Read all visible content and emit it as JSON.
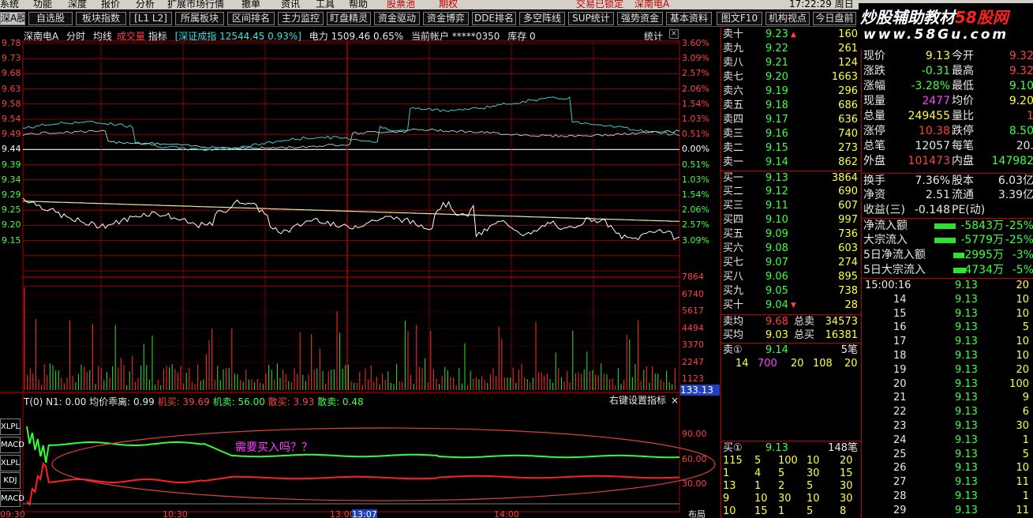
{
  "menubar": {
    "items": [
      "系统",
      "功能",
      "深度",
      "报价",
      "分析",
      "扩展市场行情",
      "撤单",
      "资讯",
      "工具",
      "帮助"
    ],
    "center_items": [
      "股票池",
      "期权"
    ],
    "status": "交易已锁定",
    "stock": "深南电A",
    "clock": "17:22:29 周日"
  },
  "toolbar": {
    "tabs": [
      "深A股",
      "自选股",
      "板块指数",
      "[L1 L2]",
      "所属板块",
      "区间排名",
      "主力监控",
      "盯盘精灵",
      "资金驱动",
      "资金博弈",
      "DDE排名",
      "多空阵线",
      "SUP统计",
      "强势资金",
      "基本资料",
      "图文F10",
      "机构视点",
      "今日盘前"
    ]
  },
  "watermark": {
    "line1_a": "炒股辅助教材",
    "line1_b": "58股网",
    "line2": "www.58Gu.com"
  },
  "chart": {
    "stock_name": "深南电A",
    "mode": "分时",
    "avg_line": "均线",
    "volume_label": "成交量",
    "indicator": "指标",
    "index_info": "[深证成指 12544.45 0.93%]",
    "sector_info": "电力 1509.46 0.65%",
    "account": "当前帐户 *****0350",
    "stock_held": "库存 0",
    "stats": "统计",
    "price_ticks": [
      "9.78",
      "9.73",
      "9.68",
      "9.63",
      "9.58",
      "9.54",
      "9.49",
      "9.44",
      "9.39",
      "9.34",
      "9.29",
      "9.25",
      "9.20",
      "9.15"
    ],
    "pct_ticks": [
      "3.60%",
      "3.09%",
      "2.57%",
      "2.06%",
      "1.54%",
      "1.03%",
      "0.51%",
      "0.00%",
      "0.51%",
      "1.03%",
      "1.54%",
      "2.06%",
      "2.57%",
      "3.09%"
    ],
    "vol_ticks": [
      "7864",
      "6740",
      "5617",
      "4494",
      "3370",
      "2247",
      "1123"
    ],
    "vol_current": "133.13",
    "ind_header": {
      "t": "T(0)",
      "n1": "N1: 0.00",
      "ratio": "均价乖离: 0.99",
      "jibuy": "机买: 39.69",
      "jisell": "机卖: 56.00",
      "sanbuy": "散买: 3.93",
      "sansell": "散卖: 0.48",
      "right_hint": "右键设置指标",
      "close": "×"
    },
    "ind_ticks": [
      "90.00",
      "60.00",
      "30.00"
    ],
    "annotation": "需要买入吗？？",
    "ind_buttons": [
      "XLPL",
      "MACD",
      "XLPL",
      "KDJ",
      "MACD"
    ],
    "time_labels": [
      "09:30",
      "10:30",
      "13:00",
      "13:07",
      "14:00"
    ],
    "bottom_right": "布局"
  },
  "quote": {
    "sells": [
      {
        "label": "卖十",
        "price": "9.23",
        "vol": "160",
        "mark": "▲"
      },
      {
        "label": "卖九",
        "price": "9.22",
        "vol": "261",
        "mark": ""
      },
      {
        "label": "卖八",
        "price": "9.21",
        "vol": "124",
        "mark": ""
      },
      {
        "label": "卖七",
        "price": "9.20",
        "vol": "1663",
        "mark": ""
      },
      {
        "label": "卖六",
        "price": "9.19",
        "vol": "296",
        "mark": ""
      },
      {
        "label": "卖五",
        "price": "9.18",
        "vol": "686",
        "mark": ""
      },
      {
        "label": "卖四",
        "price": "9.17",
        "vol": "636",
        "mark": ""
      },
      {
        "label": "卖三",
        "price": "9.16",
        "vol": "740",
        "mark": ""
      },
      {
        "label": "卖二",
        "price": "9.15",
        "vol": "273",
        "mark": ""
      },
      {
        "label": "卖一",
        "price": "9.14",
        "vol": "862",
        "mark": ""
      }
    ],
    "buys": [
      {
        "label": "买一",
        "price": "9.13",
        "vol": "3864",
        "mark": ""
      },
      {
        "label": "买二",
        "price": "9.12",
        "vol": "690",
        "mark": ""
      },
      {
        "label": "买三",
        "price": "9.11",
        "vol": "607",
        "mark": ""
      },
      {
        "label": "买四",
        "price": "9.10",
        "vol": "997",
        "mark": ""
      },
      {
        "label": "买五",
        "price": "9.09",
        "vol": "736",
        "mark": ""
      },
      {
        "label": "买六",
        "price": "9.08",
        "vol": "603",
        "mark": ""
      },
      {
        "label": "买七",
        "price": "9.07",
        "vol": "274",
        "mark": ""
      },
      {
        "label": "买八",
        "price": "9.06",
        "vol": "895",
        "mark": ""
      },
      {
        "label": "买九",
        "price": "9.05",
        "vol": "738",
        "mark": ""
      },
      {
        "label": "买十",
        "price": "9.04",
        "vol": "28",
        "mark": "▼"
      }
    ],
    "sell_avg": {
      "label": "卖均",
      "price": "9.68",
      "tl": "总卖",
      "tv": "34573"
    },
    "buy_avg": {
      "label": "买均",
      "price": "9.03",
      "tl": "总买",
      "tv": "16381"
    },
    "sell1_queue": {
      "label": "卖①",
      "price": "9.14",
      "count": "5笔",
      "values": [
        "14",
        "700",
        "20",
        "108",
        "20"
      ]
    },
    "buy1_queue": {
      "label": "买①",
      "price": "9.13",
      "count": "148笔",
      "rows": [
        [
          "115",
          "5",
          "100",
          "10",
          "20"
        ],
        [
          "1",
          "4",
          "5",
          "30",
          "15"
        ],
        [
          "13",
          "1",
          "2",
          "5",
          "30"
        ],
        [
          "9",
          "10",
          "30",
          "10",
          "30"
        ],
        [
          "10",
          "15",
          "1",
          "5",
          "8"
        ]
      ]
    }
  },
  "info": {
    "rows": [
      {
        "l1": "现价",
        "v1": "9.13",
        "l2": "今开",
        "v2": "9.32"
      },
      {
        "l1": "涨跌",
        "v1": "-0.31",
        "l2": "最高",
        "v2": "9.32"
      },
      {
        "l1": "涨幅",
        "v1": "-3.28%",
        "l2": "最低",
        "v2": "9.10"
      },
      {
        "l1": "现量",
        "v1": "2477",
        "l2": "均价",
        "v2": "9.20"
      },
      {
        "l1": "总量",
        "v1": "249455",
        "l2": "量比",
        "v2": "1"
      },
      {
        "l1": "涨停",
        "v1": "10.38",
        "l2": "跌停",
        "v2": "8.50"
      },
      {
        "l1": "总笔",
        "v1": "12057",
        "l2": "每笔",
        "v2": "20."
      },
      {
        "l1": "外盘",
        "v1": "101473",
        "l2": "内盘",
        "v2": "147982"
      },
      {
        "l1": "换手",
        "v1": "7.36%",
        "l2": "股本",
        "v2": "6.03亿"
      },
      {
        "l1": "净资",
        "v1": "2.51",
        "l2": "流通",
        "v2": "3.39亿"
      },
      {
        "l1": "收益(三)",
        "v1": "-0.148",
        "l2": "PE(动)",
        "v2": ""
      }
    ],
    "flows": [
      {
        "label": "净流入额",
        "value": "-5843万",
        "pct": "-25%",
        "bar": 0.85
      },
      {
        "label": "大宗流入",
        "value": "-5779万",
        "pct": "-25%",
        "bar": 0.85
      },
      {
        "label": "5日净流入额",
        "value": "-2995万",
        "pct": "-3%",
        "bar": 0.45
      },
      {
        "label": "5日大宗流入",
        "value": "-4734万",
        "pct": "-5%",
        "bar": 0.5
      }
    ]
  },
  "ticks": {
    "rows": [
      {
        "t": "15:00:16",
        "p": "9.13",
        "v": "20"
      },
      {
        "t": "14",
        "p": "9.13",
        "v": "10"
      },
      {
        "t": "15",
        "p": "9.13",
        "v": "10"
      },
      {
        "t": "16",
        "p": "9.13",
        "v": "5"
      },
      {
        "t": "17",
        "p": "9.13",
        "v": "10"
      },
      {
        "t": "18",
        "p": "9.13",
        "v": "10"
      },
      {
        "t": "19",
        "p": "9.13",
        "v": "20"
      },
      {
        "t": "20",
        "p": "9.13",
        "v": "100"
      },
      {
        "t": "21",
        "p": "9.13",
        "v": "9"
      },
      {
        "t": "22",
        "p": "9.13",
        "v": "6"
      },
      {
        "t": "23",
        "p": "9.13",
        "v": "30"
      },
      {
        "t": "24",
        "p": "9.13",
        "v": "1"
      },
      {
        "t": "25",
        "p": "9.13",
        "v": "5"
      },
      {
        "t": "26",
        "p": "9.13",
        "v": "10"
      },
      {
        "t": "27",
        "p": "9.13",
        "v": "11"
      },
      {
        "t": "28",
        "p": "9.13",
        "v": "1"
      },
      {
        "t": "29",
        "p": "9.13",
        "v": "11"
      }
    ]
  },
  "colors": {
    "grid_red": "#b00000",
    "price_line": "#ffffff",
    "avg_line": "#e8e8a0",
    "index_line": "#40c8c8",
    "vol_green": "#30e030",
    "vol_red": "#ff3030",
    "ind_green": "#30ff30",
    "ind_red": "#ff2020",
    "ellipse": "#e04040"
  }
}
